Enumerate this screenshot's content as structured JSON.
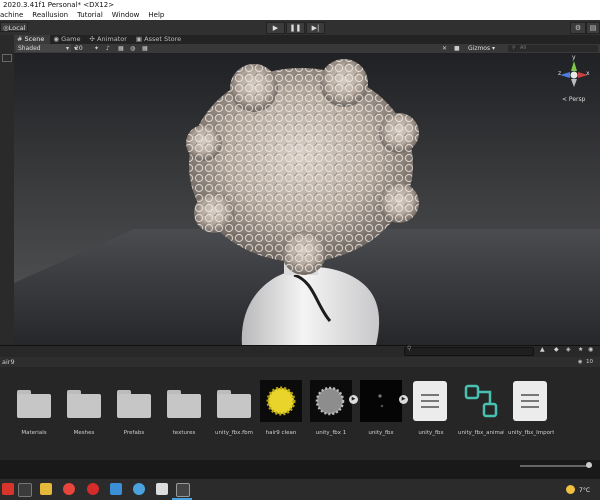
{
  "window": {
    "title": "2020.3.41f1 Personal* <DX12>"
  },
  "menu": [
    "achine",
    "Reallusion",
    "Tutorial",
    "Window",
    "Help"
  ],
  "toolbar": {
    "pivot_label": "Local",
    "play": "▶",
    "pause": "❚❚",
    "step": "▶|"
  },
  "tabs": [
    {
      "label": "Scene",
      "icon": "grid-icon"
    },
    {
      "label": "Game",
      "icon": "gamepad-icon"
    },
    {
      "label": "Animator",
      "icon": "animator-icon"
    },
    {
      "label": "Asset Store",
      "icon": "store-icon"
    }
  ],
  "scene": {
    "shading": "Shaded",
    "num": "20",
    "gizmos_label": "Gizmos",
    "search_placeholder": "All"
  },
  "gizmo": {
    "persp_label": "< Persp",
    "axis_y": "y",
    "axis_z": "z",
    "axis_x": "x"
  },
  "project": {
    "breadcrumb": "air9",
    "count": "10"
  },
  "assets": [
    {
      "label": "Materials",
      "kind": "folder"
    },
    {
      "label": "Meshes",
      "kind": "folder"
    },
    {
      "label": "Prefabs",
      "kind": "folder"
    },
    {
      "label": "textures",
      "kind": "folder"
    },
    {
      "label": "unity_fbx.fbm",
      "kind": "folder"
    },
    {
      "label": "hair9 clean",
      "kind": "material-yellow"
    },
    {
      "label": "unity_fbx 1",
      "kind": "material-grey"
    },
    {
      "label": "unity_fbx",
      "kind": "model-dark"
    },
    {
      "label": "unity_fbx",
      "kind": "doc"
    },
    {
      "label": "unity_fbx_animat...",
      "kind": "anim"
    },
    {
      "label": "unity_fbx_Importi...",
      "kind": "doc"
    }
  ],
  "taskbar": {
    "weather": "7°C"
  },
  "colors": {
    "accent": "#4aa3df",
    "folder": "#c6c6c6",
    "anim": "#49c1b0",
    "yellow": "#e8d42a"
  }
}
